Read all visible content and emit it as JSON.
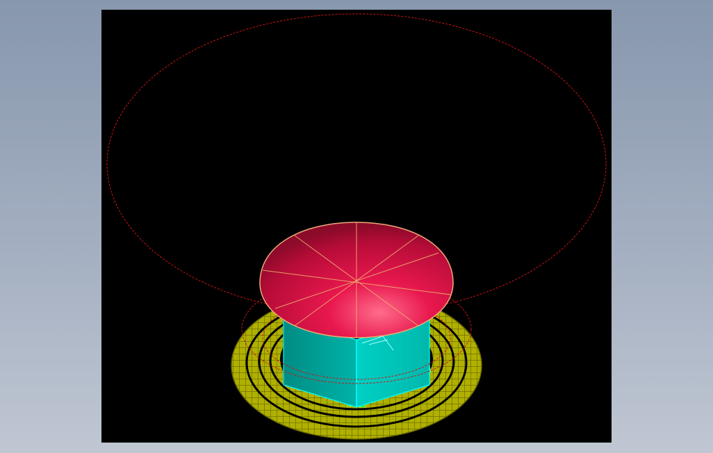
{
  "viewer": {
    "background_gradient": [
      "#8797ad",
      "#c0c7d3"
    ],
    "viewport_color": "#000000"
  },
  "model": {
    "description_parts": [
      "base-ring-plate",
      "support-box",
      "dome-cap",
      "wireframe-outline-circles"
    ],
    "colors": {
      "base_ring": "#b8b800",
      "base_ring_lines": "#4a4a00",
      "support_box_front": "#00c4b8",
      "support_box_side": "#009a90",
      "support_box_edges": "#00ffff",
      "feet": "#00e000",
      "dome": "#e0104a",
      "dome_highlight": "#ff5a7e",
      "dome_edges": "#f0b070",
      "outline_circle": "#e01010"
    }
  }
}
